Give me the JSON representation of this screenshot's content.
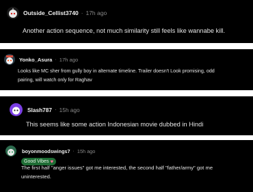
{
  "comments": [
    {
      "author": "Outside_Cellist3740",
      "time": "17h ago",
      "text": "Another action sequence, not much similarity still feels like wannabe kill.",
      "avatar": "robot-snoo-avatar-icon"
    },
    {
      "author": "Yonko_Asura",
      "time": "17h ago",
      "text_line1": "Looks like MC sher from gully boy in alternate timeline. Trailer doesn't Look promising, odd",
      "text_line2": "pairing, will watch only for Raghav",
      "avatar": "snoo-avatar-icon"
    },
    {
      "author": "Slash787",
      "time": "15h ago",
      "text": "This seems like some action Indonesian movie dubbed in Hindi",
      "avatar": "purple-snoo-avatar-icon"
    },
    {
      "author": "boyonmoodswings7",
      "time": "15h ago",
      "flair": "Good Vibes",
      "flair_emoji": "♥",
      "text_line1": "The first half \"anger issues\" got me interested, the second half \"father/army\" got me",
      "text_line2": "uninterested.",
      "avatar": "green-snoo-avatar-icon"
    }
  ],
  "colors": {
    "background": "#000000",
    "text": "#e6e6e6",
    "meta": "#8a8a8a",
    "flair_bg": "#1f6d35"
  }
}
